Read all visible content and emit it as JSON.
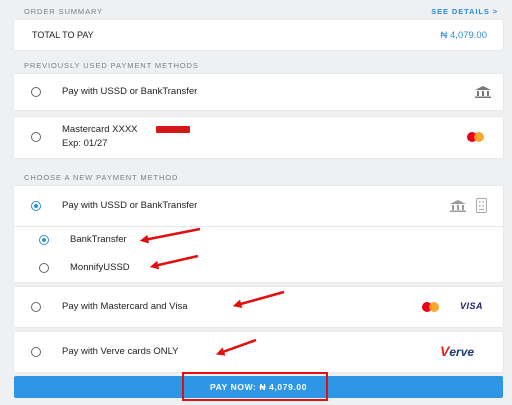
{
  "order_summary": {
    "header": "ORDER SUMMARY",
    "see_details": "SEE DETAILS >",
    "total_label": "TOTAL TO PAY",
    "total_amount": "₦ 4,079.00"
  },
  "previous": {
    "header": "PREVIOUSLY USED PAYMENT METHODS",
    "ussd_label": "Pay with USSD or BankTransfer",
    "card_number": "Mastercard XXXX",
    "card_exp": "Exp: 01/27"
  },
  "new_method": {
    "header": "CHOOSE A NEW PAYMENT METHOD",
    "ussd_label": "Pay with USSD or BankTransfer",
    "sub_options": [
      "BankTransfer",
      "MonnifyUSSD"
    ],
    "mastercard_visa_label": "Pay with Mastercard and Visa",
    "visa_text": "VISA",
    "verve_label": "Pay with Verve cards ONLY",
    "verve_logo_v": "V",
    "verve_logo_rest": "erve"
  },
  "pay_button": "PAY NOW: ₦ 4,079.00",
  "colors": {
    "accent": "#2f8bd8",
    "button": "#2f96e6",
    "annotation_red": "#e01010"
  }
}
